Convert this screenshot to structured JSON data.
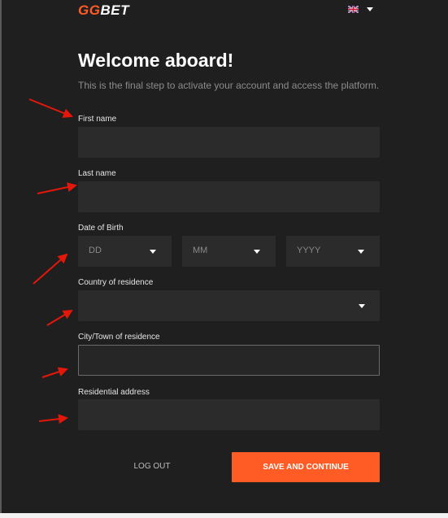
{
  "header": {
    "logo_gg": "GG",
    "logo_bet": "BET",
    "language_icon": "uk-flag-icon"
  },
  "main": {
    "title": "Welcome aboard!",
    "subtitle": "This is the final step to activate your account and access the platform."
  },
  "form": {
    "first_name_label": "First name",
    "last_name_label": "Last name",
    "dob_label": "Date of Birth",
    "dob_day_placeholder": "DD",
    "dob_month_placeholder": "MM",
    "dob_year_placeholder": "YYYY",
    "country_label": "Country of residence",
    "city_label": "City/Town of residence",
    "address_label": "Residential address"
  },
  "actions": {
    "logout_label": "LOG OUT",
    "save_label": "SAVE AND CONTINUE"
  },
  "colors": {
    "accent": "#ff5b24",
    "background": "#1f1f1f",
    "input_background": "#2b2b2b",
    "annotation_arrow": "#e3170a"
  }
}
